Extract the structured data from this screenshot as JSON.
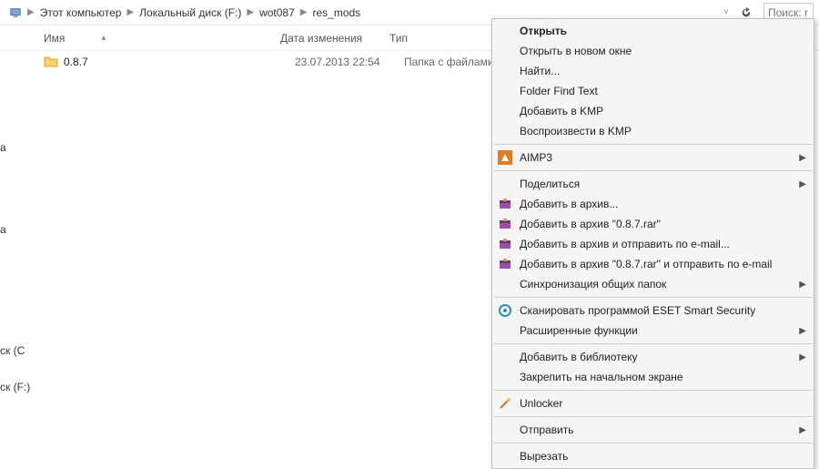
{
  "breadcrumb": {
    "items": [
      "Этот компьютер",
      "Локальный диск (F:)",
      "wot087",
      "res_mods"
    ]
  },
  "toolbar": {
    "search_placeholder": "Поиск: r"
  },
  "columns": {
    "name": "Имя",
    "date": "Дата изменения",
    "type": "Тип"
  },
  "files": [
    {
      "name": "0.8.7",
      "date": "23.07.2013 22:54",
      "type": "Папка с файлами"
    }
  ],
  "left_fragments": {
    "a1": "а",
    "a2": "а",
    "c": "ск (C",
    "f": "ск (F:)"
  },
  "context_menu": {
    "open": "Открыть",
    "open_new": "Открыть в новом окне",
    "find": "Найти...",
    "folder_find": "Folder Find Text",
    "add_kmp": "Добавить в KMP",
    "play_kmp": "Воспроизвести в KMP",
    "aimp": "AIMP3",
    "share": "Поделиться",
    "add_archive": "Добавить в архив...",
    "add_archive_name": "Добавить в архив \"0.8.7.rar\"",
    "add_archive_email": "Добавить в архив и отправить по e-mail...",
    "add_archive_name_email": "Добавить в архив \"0.8.7.rar\" и отправить по e-mail",
    "sync": "Синхронизация общих папок",
    "eset_scan": "Сканировать программой ESET Smart Security",
    "eset_adv": "Расширенные функции",
    "add_library": "Добавить в библиотеку",
    "pin_start": "Закрепить на начальном экране",
    "unlocker": "Unlocker",
    "send": "Отправить",
    "cut": "Вырезать"
  }
}
